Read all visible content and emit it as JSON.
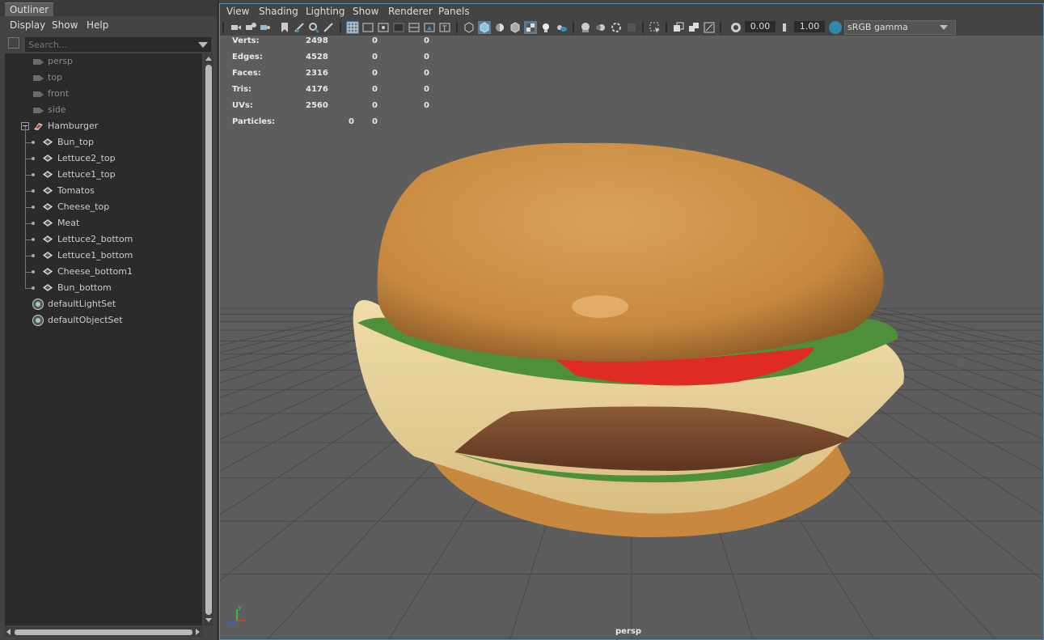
{
  "outliner": {
    "tab_title": "Outliner",
    "menu": [
      "Display",
      "Show",
      "Help"
    ],
    "search_placeholder": "Search...",
    "items": [
      {
        "label": "persp",
        "kind": "camera",
        "color": "#8a8a8a"
      },
      {
        "label": "top",
        "kind": "camera",
        "color": "#8a8a8a"
      },
      {
        "label": "front",
        "kind": "camera",
        "color": "#8a8a8a"
      },
      {
        "label": "side",
        "kind": "camera",
        "color": "#8a8a8a"
      },
      {
        "label": "Hamburger",
        "kind": "group",
        "color": "#cccccc"
      },
      {
        "label": "Bun_top",
        "kind": "mesh",
        "color": "#cccccc"
      },
      {
        "label": "Lettuce2_top",
        "kind": "mesh",
        "color": "#cccccc"
      },
      {
        "label": "Lettuce1_top",
        "kind": "mesh",
        "color": "#cccccc"
      },
      {
        "label": "Tomatos",
        "kind": "mesh",
        "color": "#cccccc"
      },
      {
        "label": "Cheese_top",
        "kind": "mesh",
        "color": "#cccccc"
      },
      {
        "label": "Meat",
        "kind": "mesh",
        "color": "#cccccc"
      },
      {
        "label": "Lettuce2_bottom",
        "kind": "mesh",
        "color": "#cccccc"
      },
      {
        "label": "Lettuce1_bottom",
        "kind": "mesh",
        "color": "#cccccc"
      },
      {
        "label": "Cheese_bottom1",
        "kind": "mesh",
        "color": "#cccccc"
      },
      {
        "label": "Bun_bottom",
        "kind": "mesh",
        "color": "#cccccc"
      },
      {
        "label": "defaultLightSet",
        "kind": "set",
        "color": "#cccccc"
      },
      {
        "label": "defaultObjectSet",
        "kind": "set",
        "color": "#cccccc"
      }
    ]
  },
  "viewport": {
    "menu": [
      "View",
      "Shading",
      "Lighting",
      "Show",
      "Renderer",
      "Panels"
    ],
    "exposure_value": "0.00",
    "gamma_value": "1.00",
    "color_space": "sRGB gamma",
    "camera_label": "persp",
    "hud": [
      {
        "label": "Verts:",
        "values": [
          "2498",
          "0",
          "0"
        ]
      },
      {
        "label": "Edges:",
        "values": [
          "4528",
          "0",
          "0"
        ]
      },
      {
        "label": "Faces:",
        "values": [
          "2316",
          "0",
          "0"
        ]
      },
      {
        "label": "Tris:",
        "values": [
          "4176",
          "0",
          "0"
        ]
      },
      {
        "label": "UVs:",
        "values": [
          "2560",
          "0",
          "0"
        ]
      },
      {
        "label": "Particles:",
        "values": [
          "0",
          "0"
        ]
      }
    ],
    "axis_labels": {
      "x": "x",
      "y": "y",
      "z": "z"
    },
    "colors": {
      "background": "#5d5d5d",
      "grid": "#4a4a4a",
      "bun": "#c8893f",
      "lettuce": "#4d8f3a",
      "tomato": "#e02a24",
      "cheese": "#e6cf98",
      "meat": "#7a4a30",
      "active_border": "#5a8fb0"
    }
  }
}
